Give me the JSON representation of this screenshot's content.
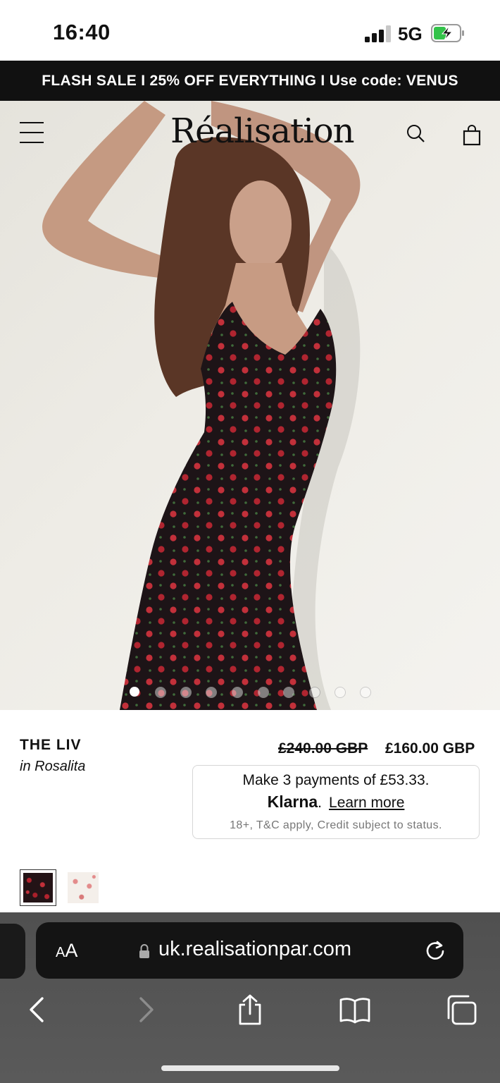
{
  "status_bar": {
    "time": "16:40",
    "network": "5G",
    "signal_bars": 3,
    "battery_charging": true
  },
  "banner": {
    "text": "FLASH SALE I 25% OFF EVERYTHING I Use code: VENUS"
  },
  "header": {
    "logo": "Réalisation"
  },
  "carousel": {
    "total": 10,
    "active_index": 0
  },
  "product": {
    "name": "THE LIV",
    "variant": "in Rosalita",
    "original_price": "£240.00 GBP",
    "sale_price": "£160.00 GBP",
    "klarna": {
      "line1": "Make 3 payments of £53.33.",
      "brand": "Klarna",
      "brand_suffix": ".",
      "link": "Learn more",
      "disclaimer": "18+, T&C apply, Credit subject to status."
    },
    "swatches": [
      "Rosalita (black)",
      "white floral"
    ]
  },
  "browser": {
    "text_size_label_small": "A",
    "text_size_label_large": "A",
    "url": "uk.realisationpar.com"
  },
  "colors": {
    "banner_bg": "#111111",
    "toolbar_bg": "#555555",
    "dress": "#1c1416",
    "rose": "#c0303a"
  }
}
